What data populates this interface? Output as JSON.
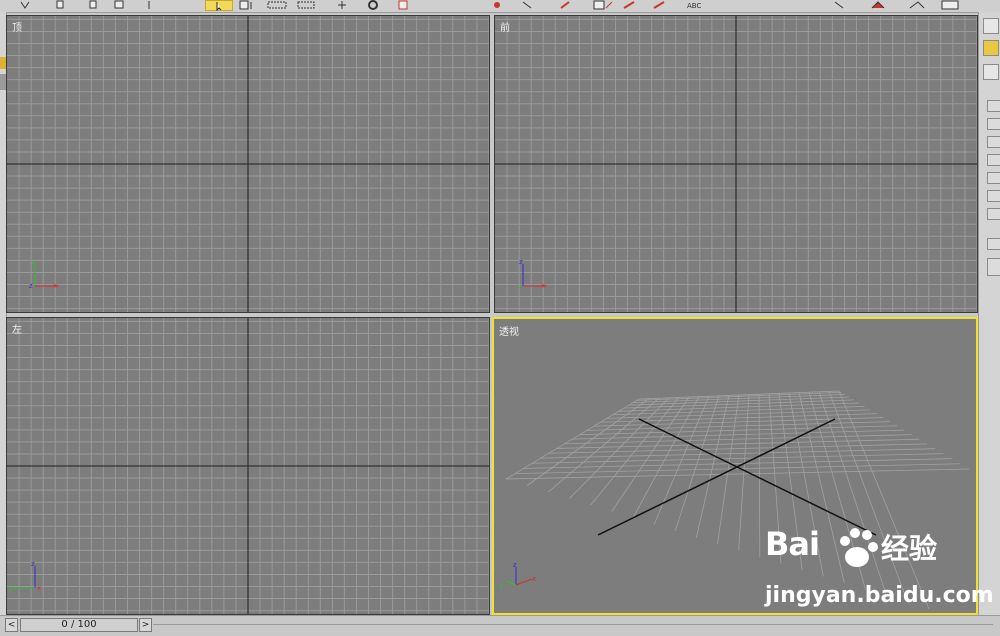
{
  "viewports": {
    "top": {
      "label": "顶"
    },
    "front": {
      "label": "前"
    },
    "left": {
      "label": "左"
    },
    "perspective": {
      "label": "透视"
    }
  },
  "axes": {
    "x": "x",
    "y": "y",
    "z": "z"
  },
  "toolbar": {
    "icons": [
      "undo-icon",
      "redo-icon",
      "link-icon",
      "unlink-icon",
      "select-icon",
      "select-by-name-icon",
      "region-select-icon",
      "window-crossing-icon",
      "move-icon",
      "rotate-icon",
      "scale-icon",
      "mirror-icon",
      "align-icon",
      "layer-icon",
      "curve-editor-icon",
      "schematic-icon",
      "material-icon",
      "render-icon",
      "text-abc-icon"
    ]
  },
  "timeslider": {
    "position": "0 / 100",
    "prev_label": "<",
    "next_label": ">"
  },
  "watermark": {
    "brand": "Bai",
    "brand2": "经验",
    "url": "jingyan.baidu.com"
  },
  "colors": {
    "viewport_bg": "#7d7d7d",
    "grid": "#999999",
    "active_border": "#f0e030",
    "axis_x": "#d03030",
    "axis_y": "#30c030",
    "axis_z": "#3030d0"
  }
}
